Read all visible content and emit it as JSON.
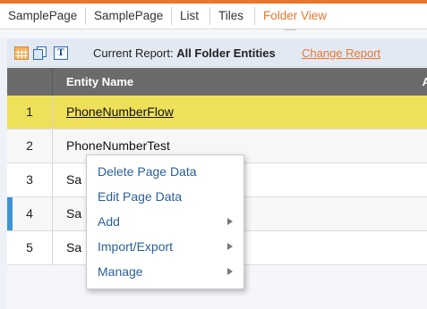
{
  "tabs": [
    {
      "label": "SamplePage",
      "active": false
    },
    {
      "label": "SamplePage",
      "active": false
    },
    {
      "label": "List",
      "active": false
    },
    {
      "label": "Tiles",
      "active": false
    },
    {
      "label": "Folder View",
      "active": true
    }
  ],
  "toolbar": {
    "icons": [
      "grid-view-icon",
      "pages-icon",
      "text-icon"
    ],
    "text_icon_glyph": "T",
    "report_prefix": "Current Report: ",
    "report_name": "All Folder Entities",
    "change_report": "Change Report"
  },
  "grid": {
    "columns": [
      "",
      "Entity Name"
    ],
    "rows": [
      {
        "num": "1",
        "name": "PhoneNumberFlow",
        "selected": true
      },
      {
        "num": "2",
        "name": "PhoneNumberTest",
        "selected": false
      },
      {
        "num": "3",
        "name": "Sa",
        "selected": false
      },
      {
        "num": "4",
        "name": "Sa",
        "selected": false,
        "marked": true
      },
      {
        "num": "5",
        "name": "Sa",
        "selected": false
      }
    ]
  },
  "context_menu": {
    "items": [
      {
        "label": "Delete Page Data",
        "submenu": false
      },
      {
        "label": "Edit Page Data",
        "submenu": false
      },
      {
        "label": "Add",
        "submenu": true
      },
      {
        "label": "Import/Export",
        "submenu": true
      },
      {
        "label": "Manage",
        "submenu": true
      }
    ]
  },
  "colors": {
    "accent": "#e8772e",
    "selected_row": "#efe05a",
    "header_bg": "#6b6b6b",
    "menu_text": "#2a5f99",
    "row_marker": "#3e95d4"
  }
}
